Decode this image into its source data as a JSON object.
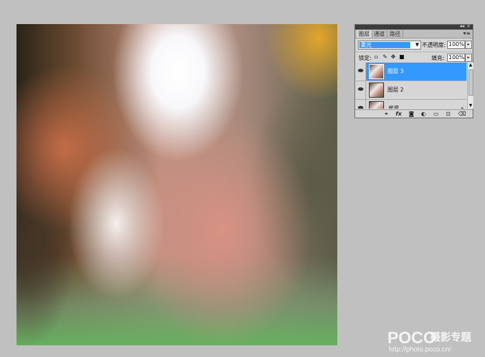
{
  "canvas": {
    "description_color_top": "#f8f8fb",
    "accent_orange": "#e8aa28",
    "bottom_green": "#67b060"
  },
  "layers_panel": {
    "tabs": [
      {
        "label": "图层",
        "active": true
      },
      {
        "label": "通道",
        "active": false
      },
      {
        "label": "路径",
        "active": false
      }
    ],
    "topbar_collapse": "◂◂",
    "topbar_close": "×",
    "menu_button": "▾≡",
    "blend_mode": "柔光",
    "opacity_label": "不透明度:",
    "opacity_value": "100%",
    "lock_label": "锁定:",
    "fill_label": "填充:",
    "fill_value": "100%",
    "layers": [
      {
        "name": "图层 3",
        "selected": true,
        "visible": true
      },
      {
        "name": "图层 2",
        "selected": false,
        "visible": true
      },
      {
        "name": "背景",
        "selected": false,
        "visible": true,
        "locked": true
      }
    ],
    "selection_color": "#3399ff"
  },
  "watermark": {
    "logo": "POCO",
    "title": "摄影专题",
    "url": "http://photo.poco.cn/"
  }
}
